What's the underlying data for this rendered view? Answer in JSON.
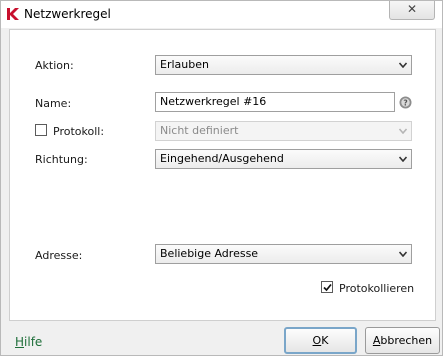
{
  "window": {
    "title": "Netzwerkregel",
    "close_label": "✕"
  },
  "form": {
    "action": {
      "label": "Aktion:",
      "value": "Erlauben"
    },
    "name": {
      "label": "Name:",
      "value": "Netzwerkregel #16"
    },
    "protocol": {
      "label": "Protokoll:",
      "value": "Nicht definiert",
      "checked": false,
      "disabled": true
    },
    "direction": {
      "label": "Richtung:",
      "value": "Eingehend/Ausgehend"
    },
    "address": {
      "label": "Adresse:",
      "value": "Beliebige Adresse"
    },
    "logging": {
      "label": "Protokollieren",
      "checked": true
    }
  },
  "footer": {
    "help_prefix": "H",
    "help_rest": "ilfe",
    "ok_prefix": "O",
    "ok_rest": "K",
    "cancel_prefix": "A",
    "cancel_rest": "bbrechen"
  },
  "colors": {
    "accent": "#c8102e",
    "help_link": "#1f6f3a"
  }
}
